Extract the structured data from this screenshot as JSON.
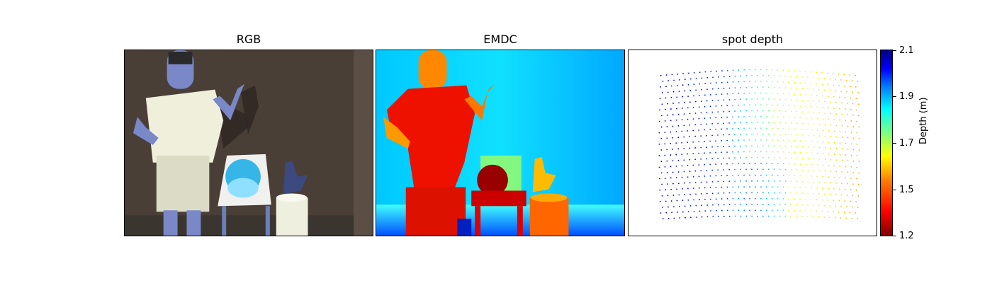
{
  "panels": [
    {
      "title": "RGB"
    },
    {
      "title": "EMDC"
    },
    {
      "title": "spot depth"
    }
  ],
  "colorbar": {
    "label": "Depth (m)",
    "ticks": [
      "2.1",
      "1.9",
      "1.7",
      "1.5",
      "1.2"
    ],
    "range": [
      1.2,
      2.1
    ],
    "colormap": "jet"
  }
}
